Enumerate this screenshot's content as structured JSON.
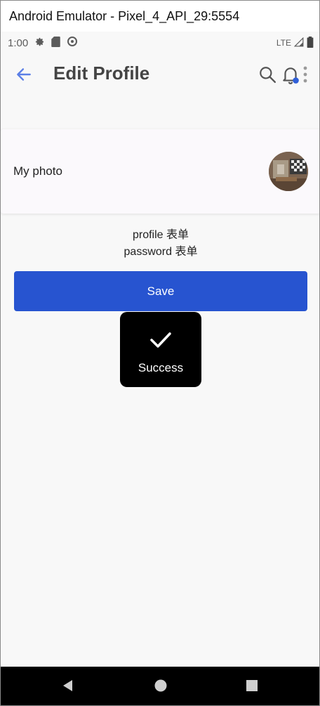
{
  "window": {
    "title": "Android Emulator - Pixel_4_API_29:5554"
  },
  "status_bar": {
    "time": "1:00",
    "network": "LTE",
    "icons": [
      "settings-icon",
      "sd-card-icon",
      "do-not-disturb-icon",
      "signal-icon",
      "battery-icon"
    ]
  },
  "app_bar": {
    "title": "Edit Profile",
    "icons": [
      "back-arrow-icon",
      "search-icon",
      "bell-icon",
      "more-vert-icon"
    ],
    "accent_color": "#5b7fe6"
  },
  "photo_section": {
    "label": "My photo"
  },
  "forms": {
    "profile_label": "profile 表单",
    "password_label": "password 表单"
  },
  "save_button": {
    "label": "Save",
    "color": "#2754d0"
  },
  "toast": {
    "text": "Success",
    "icon": "check-icon"
  },
  "nav_bar": {
    "icons": [
      "nav-back-icon",
      "nav-home-icon",
      "nav-recents-icon"
    ]
  }
}
